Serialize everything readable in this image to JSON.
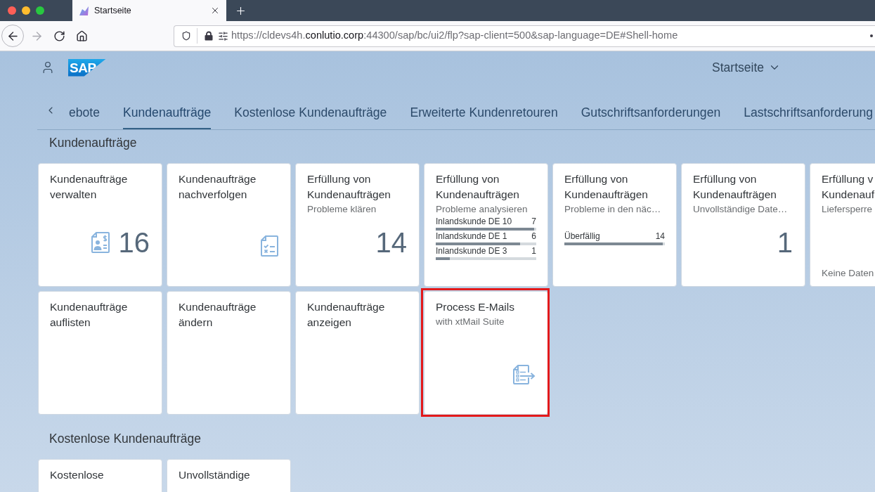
{
  "browser": {
    "tab_title": "Startseite",
    "url": {
      "start": "https://cldevs4h.",
      "domain": "conlutio.corp",
      "rest": ":44300/sap/bc/ui2/flp?sap-client=500&sap-language=DE#Shell-home"
    }
  },
  "shell": {
    "logo": "SAP",
    "title": "Startseite"
  },
  "tabs": [
    {
      "label": "ebote",
      "selected": false
    },
    {
      "label": "Kundenaufträge",
      "selected": true
    },
    {
      "label": "Kostenlose Kundenaufträge",
      "selected": false
    },
    {
      "label": "Erweiterte Kundenretouren",
      "selected": false
    },
    {
      "label": "Gutschriftsanforderungen",
      "selected": false
    },
    {
      "label": "Lastschriftsanforderung",
      "selected": false
    }
  ],
  "sections": [
    {
      "title": "Kundenaufträge",
      "rows": [
        [
          {
            "title": "Kundenaufträge verwalten",
            "number": "16",
            "highlighted": false
          },
          {
            "title": "Kundenaufträge nachverfolgen",
            "highlighted": false
          },
          {
            "title": "Erfüllung von Kundenaufträgen",
            "subtitle": "Probleme klären",
            "number": "14",
            "highlighted": false
          },
          {
            "title": "Erfüllung von Kundenaufträgen",
            "subtitle": "Probleme analysieren",
            "bars": [
              {
                "label": "Inlandskunde DE 10",
                "value": "7",
                "level": 1
              },
              {
                "label": "Inlandskunde DE 1",
                "value": "6",
                "level": 0.86
              },
              {
                "label": "Inlandskunde DE 3",
                "value": "1",
                "level": 0.14
              }
            ],
            "highlighted": false
          },
          {
            "title": "Erfüllung von Kundenaufträgen",
            "subtitle": "Probleme in den näc…",
            "bars": [
              {
                "label": "Überfällig",
                "value": "14",
                "level": 1
              }
            ],
            "highlighted": false
          },
          {
            "title": "Erfüllung von Kundenaufträgen",
            "subtitle": "Unvollständige Date…",
            "number": "1",
            "highlighted": false
          },
          {
            "title": "Erfüllung v\nKundenauf",
            "subtitle": "Liefersperre",
            "footer": "Keine Daten",
            "highlighted": false
          }
        ],
        [
          {
            "title": "Kundenaufträge auflisten",
            "highlighted": false
          },
          {
            "title": "Kundenaufträge ändern",
            "highlighted": false
          },
          {
            "title": "Kundenaufträge anzeigen",
            "highlighted": false
          },
          {
            "title": "Process E-Mails",
            "subtitle": "with xtMail Suite",
            "highlighted": true
          }
        ]
      ]
    },
    {
      "title": "Kostenlose Kundenaufträge",
      "rows": [
        [
          {
            "title": "Kostenlose",
            "highlighted": false
          },
          {
            "title": "Unvollständige",
            "highlighted": false
          }
        ]
      ]
    }
  ]
}
